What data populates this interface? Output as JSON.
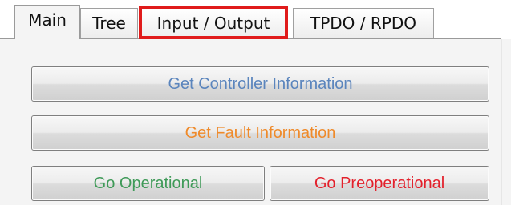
{
  "tabs": [
    {
      "label": "Main",
      "active": true
    },
    {
      "label": "Tree",
      "active": false
    },
    {
      "label": "Input / Output",
      "active": false,
      "highlighted": true
    },
    {
      "label": "TPDO / RPDO",
      "active": false
    }
  ],
  "buttons": {
    "get_controller_information": {
      "label": "Get Controller Information",
      "color": "#5b85bd"
    },
    "get_fault_information": {
      "label": "Get Fault Information",
      "color": "#ef8a2a"
    },
    "go_operational": {
      "label": "Go Operational",
      "color": "#3f9a58"
    },
    "go_preoperational": {
      "label": "Go Preoperational",
      "color": "#e3202b"
    }
  },
  "colors": {
    "highlight_box": "#e01b1b"
  }
}
